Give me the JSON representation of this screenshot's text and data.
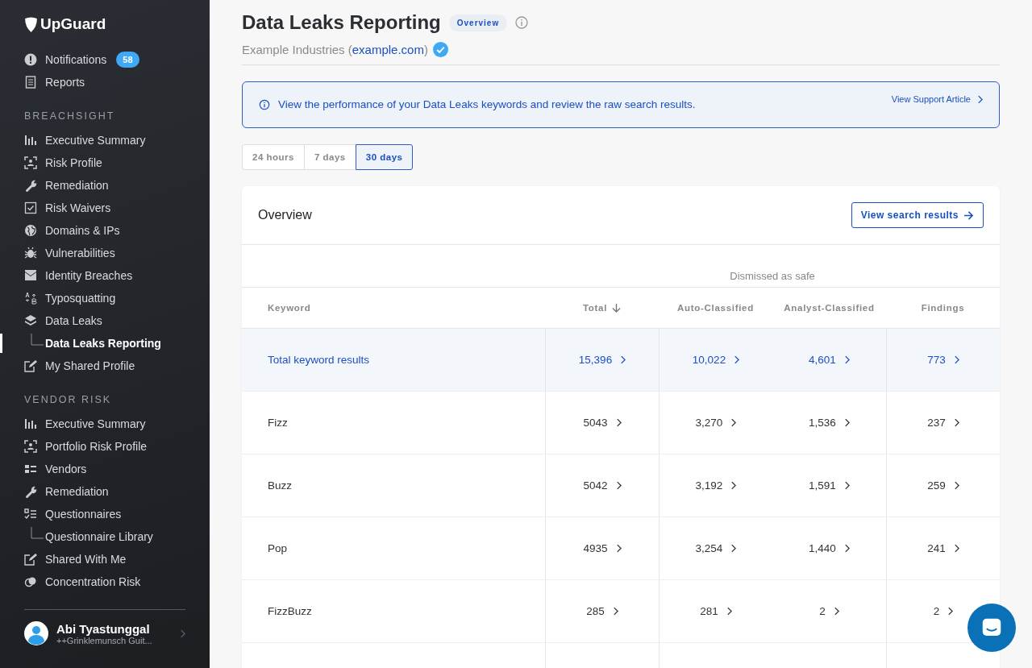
{
  "sidebar": {
    "logo": "UpGuard",
    "top_items": [
      {
        "label": "Notifications",
        "badge": "58",
        "selected": false
      },
      {
        "label": "Reports",
        "selected": false
      }
    ],
    "sections": [
      {
        "title": "BREACHSIGHT",
        "items": [
          {
            "label": "Executive Summary",
            "selected": false
          },
          {
            "label": "Risk Profile",
            "selected": false
          },
          {
            "label": "Remediation",
            "selected": false
          },
          {
            "label": "Risk Waivers",
            "selected": false
          },
          {
            "label": "Domains & IPs",
            "selected": false
          },
          {
            "label": "Vulnerabilities",
            "selected": false
          },
          {
            "label": "Identity Breaches",
            "selected": false
          },
          {
            "label": "Typosquatting",
            "selected": false
          },
          {
            "label": "Data Leaks",
            "selected": false,
            "children": [
              {
                "label": "Data Leaks Reporting",
                "selected": true
              }
            ]
          },
          {
            "label": "My Shared Profile",
            "selected": false
          }
        ]
      },
      {
        "title": "VENDOR RISK",
        "items": [
          {
            "label": "Executive Summary",
            "selected": false
          },
          {
            "label": "Portfolio Risk Profile",
            "selected": false
          },
          {
            "label": "Vendors",
            "selected": false
          },
          {
            "label": "Remediation",
            "selected": false
          },
          {
            "label": "Questionnaires",
            "selected": false,
            "children": [
              {
                "label": "Questionnaire Library",
                "selected": false
              }
            ]
          },
          {
            "label": "Shared With Me",
            "selected": false
          },
          {
            "label": "Concentration Risk",
            "selected": false
          }
        ]
      }
    ],
    "user": {
      "name": "Abi Tyastunggal",
      "org": "++Grinklemunsch Guit..."
    }
  },
  "header": {
    "title": "Data Leaks Reporting",
    "badge": "Overview",
    "company": "Example Industries",
    "domain_open": "(",
    "domain": "example.com",
    "domain_close": ")",
    "verified": true
  },
  "banner": {
    "text": "View the performance of your Data Leaks keywords and review the raw search results.",
    "link": "View Support Article"
  },
  "periods": [
    {
      "label": "24 hours",
      "selected": false
    },
    {
      "label": "7 days",
      "selected": false
    },
    {
      "label": "30 days",
      "selected": true
    }
  ],
  "overview": {
    "title": "Overview",
    "button": "View search results",
    "group_header": "Dismissed as safe",
    "columns": [
      {
        "label": "Keyword",
        "sorted": false
      },
      {
        "label": "Total",
        "sorted": true
      },
      {
        "label": "Auto-Classified",
        "sorted": false
      },
      {
        "label": "Analyst-Classified",
        "sorted": false
      },
      {
        "label": "Findings",
        "sorted": false
      }
    ],
    "rows": [
      {
        "kind": "total",
        "cells": [
          "Total keyword results",
          "15,396",
          "10,022",
          "4,601",
          "773"
        ]
      },
      {
        "kind": "keyword",
        "cells": [
          "Fizz",
          "5043",
          "3,270",
          "1,536",
          "237"
        ]
      },
      {
        "kind": "keyword",
        "cells": [
          "Buzz",
          "5042",
          "3,192",
          "1,591",
          "259"
        ]
      },
      {
        "kind": "keyword",
        "cells": [
          "Pop",
          "4935",
          "3,254",
          "1,440",
          "241"
        ]
      },
      {
        "kind": "keyword",
        "cells": [
          "FizzBuzz",
          "285",
          "281",
          "2",
          "2"
        ]
      }
    ]
  }
}
